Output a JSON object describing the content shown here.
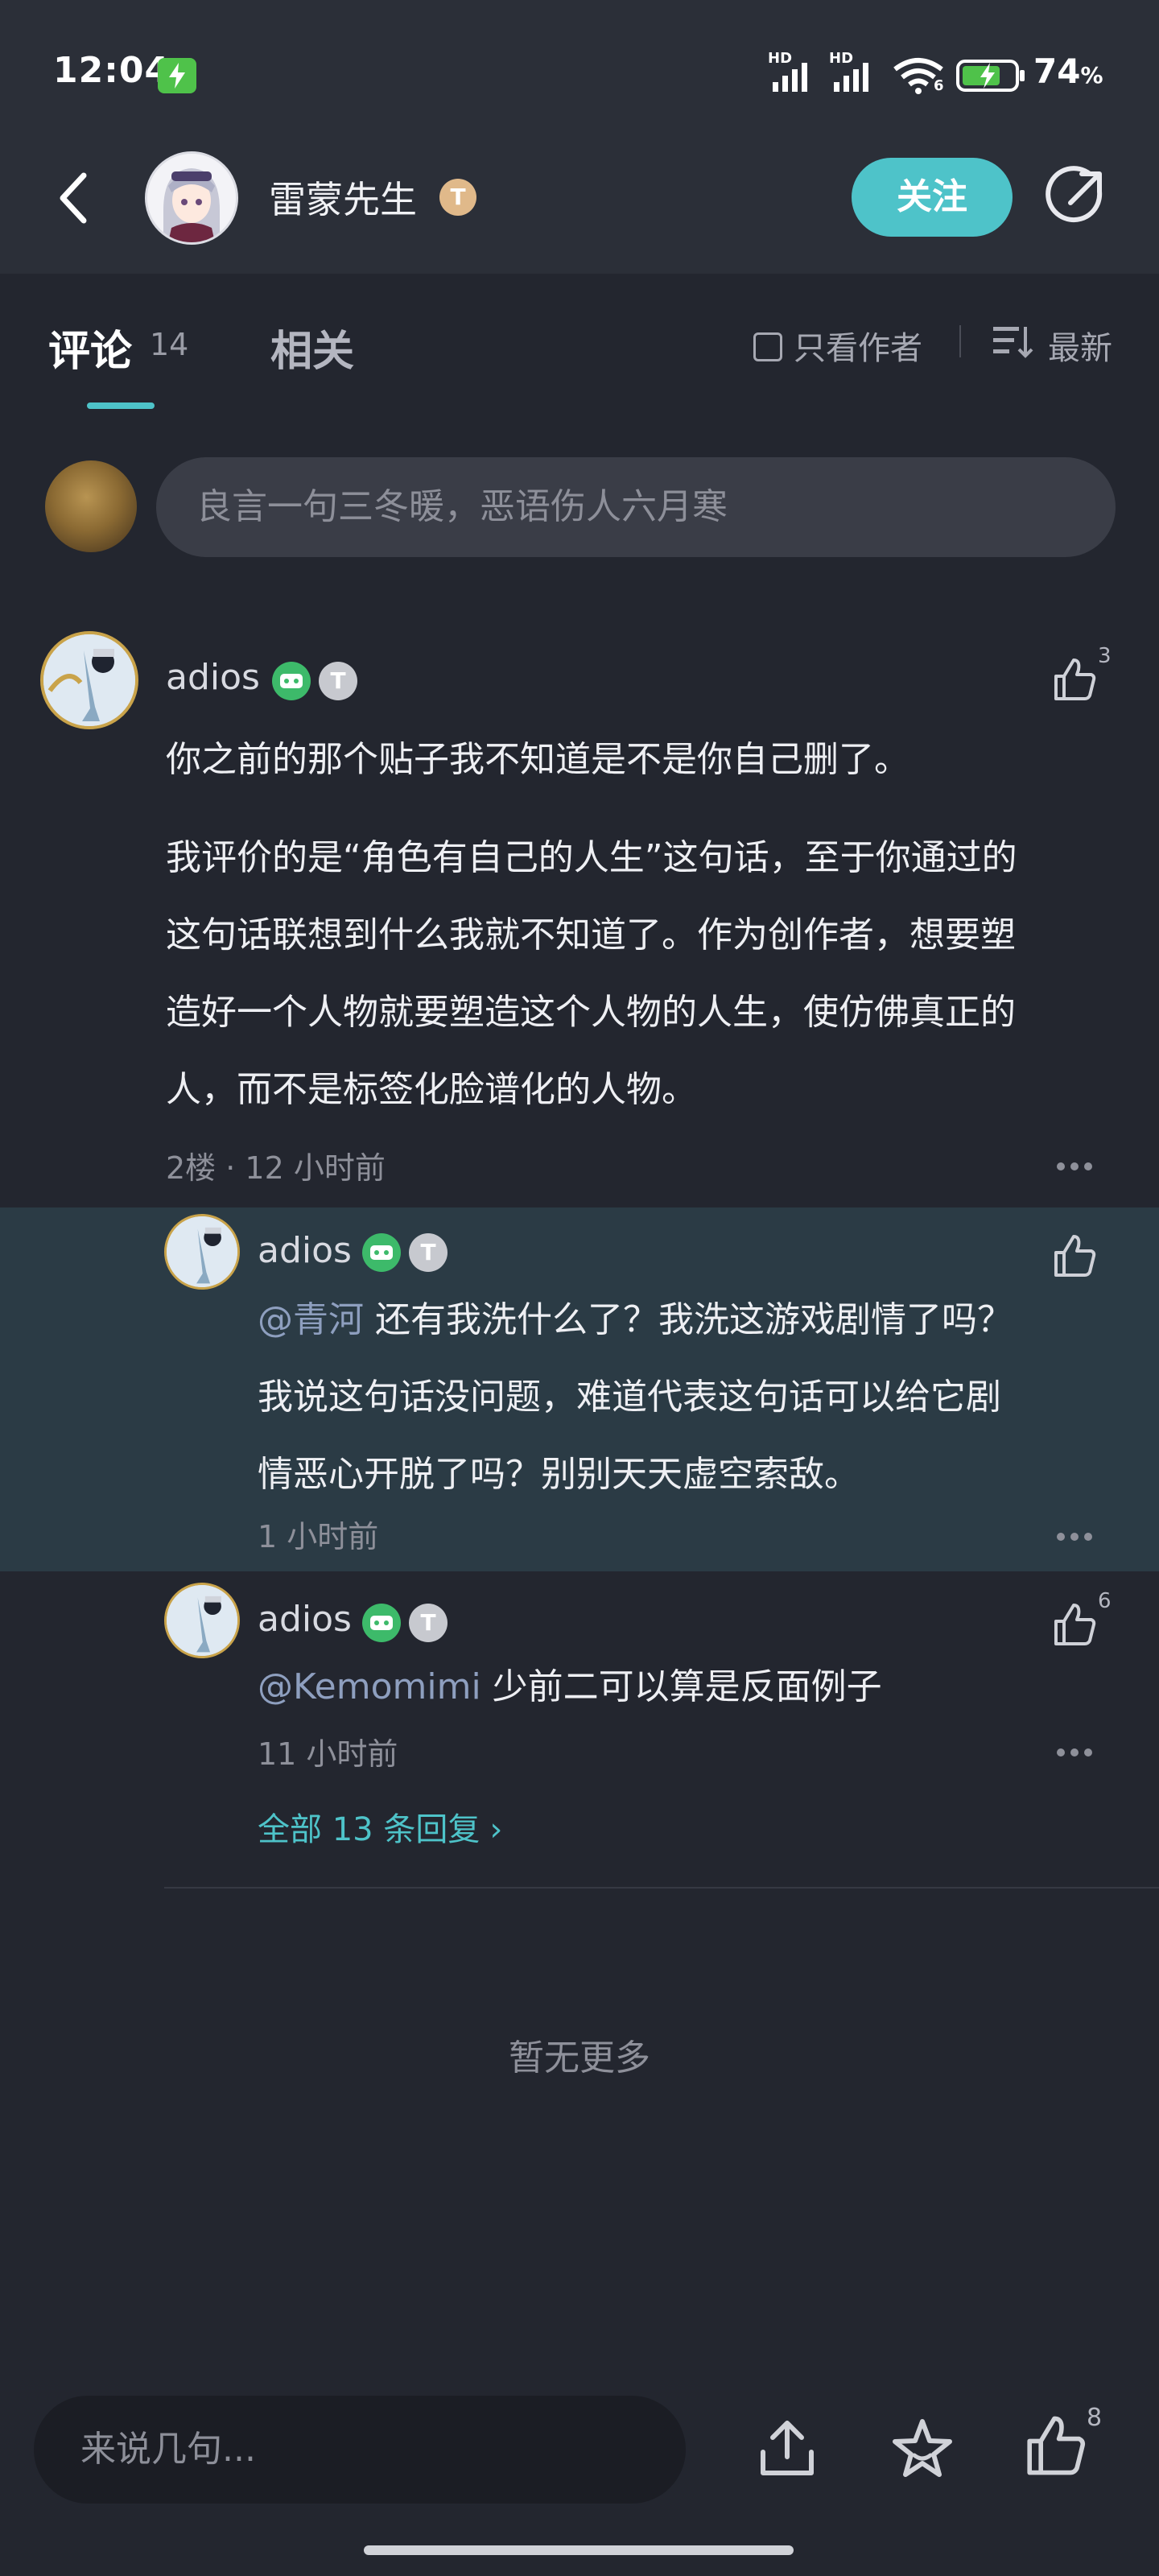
{
  "status_bar": {
    "time": "12:04",
    "battery_percent": "74",
    "battery_unit": "%",
    "signal_label_1": "HD",
    "signal_label_2": "HD",
    "wifi_badge": "6"
  },
  "nav": {
    "author_name": "雷蒙先生",
    "author_level_badge": "T",
    "follow_label": "关注"
  },
  "tabs": {
    "comments_label": "评论",
    "comments_count": "14",
    "related_label": "相关",
    "author_only_label": "只看作者",
    "sort_label": "最新"
  },
  "composer": {
    "placeholder": "良言一句三冬暖，恶语伤人六月寒"
  },
  "main_comment": {
    "username": "adios",
    "badge_t": "T",
    "like_count": "3",
    "paragraph_1": "你之前的那个贴子我不知道是不是你自己删了。",
    "paragraph_2_line_1": "我评价的是“角色有自己的人生”这句话，至于你通过的",
    "paragraph_2_line_2": "这句话联想到什么我就不知道了。作为创作者，想要塑",
    "paragraph_2_line_3": "造好一个人物就要塑造这个人物的人生，使仿佛真正的",
    "paragraph_2_line_4": "人，而不是标签化脸谱化的人物。",
    "floor_meta": "2楼 · 12 小时前"
  },
  "replies": [
    {
      "username": "adios",
      "badge_t": "T",
      "like_count": "",
      "mention": "@青河",
      "line_1": "  还有我洗什么了？我洗这游戏剧情了吗？",
      "line_2": "我说这句话没问题，难道代表这句话可以给它剧",
      "line_3": "情恶心开脱了吗？别别天天虚空索敌。",
      "time": "1 小时前"
    },
    {
      "username": "adios",
      "badge_t": "T",
      "like_count": "6",
      "mention": "@Kemomimi",
      "line_1": "  少前二可以算是反面例子",
      "time": "11 小时前"
    }
  ],
  "view_all_replies": "全部 13 条回复",
  "no_more": "暂无更多",
  "bottom_bar": {
    "input_placeholder": "来说几句...",
    "like_count": "8"
  },
  "colors": {
    "accent": "#4ec3c9",
    "background": "#23262f",
    "header_bg": "#2b2f38",
    "highlight_bg": "#2b3b45"
  }
}
